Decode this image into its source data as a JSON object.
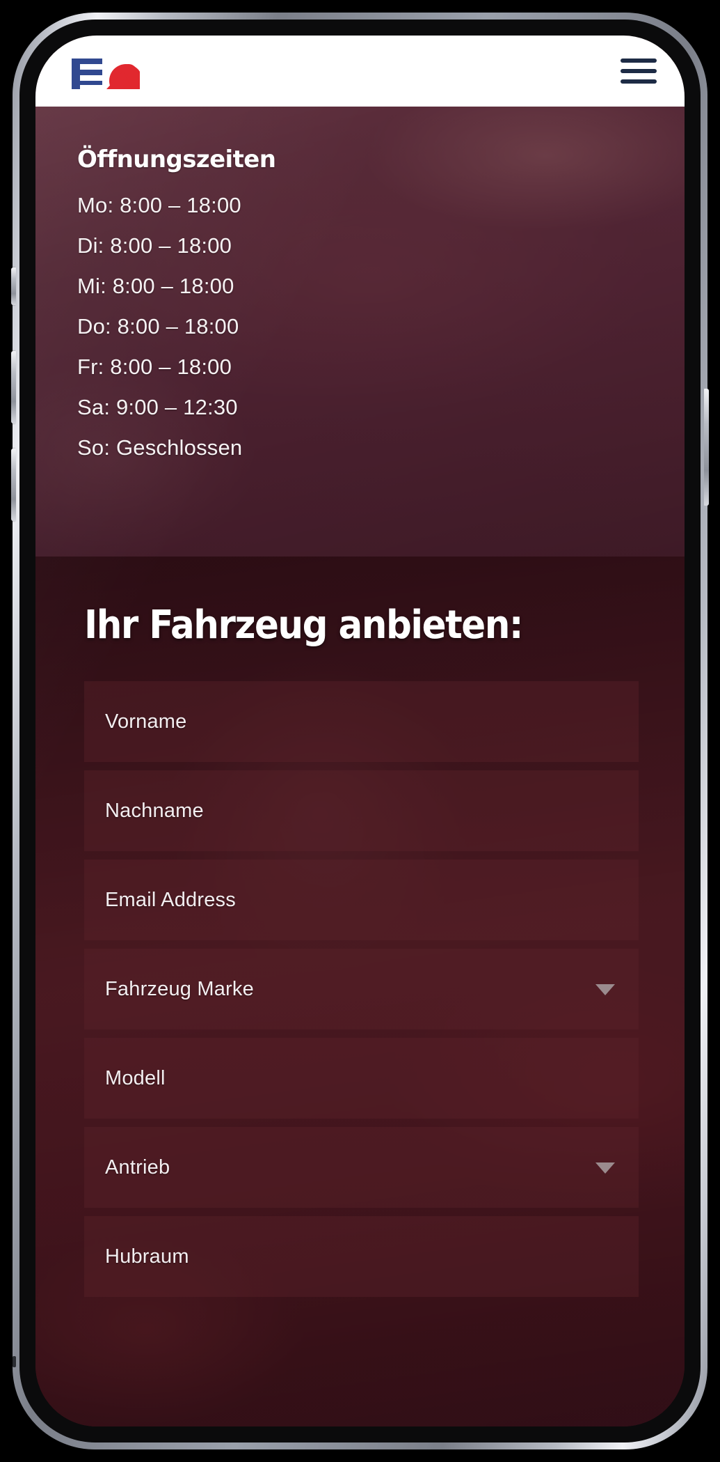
{
  "header": {
    "logo": {
      "icon": "ea-logo-icon",
      "letter_left": "E",
      "letter_right": "A",
      "color_left": "#27408b",
      "color_right": "#e01f26"
    },
    "menu_toggle": {
      "icon": "hamburger-menu-icon",
      "label": "Menü",
      "color": "#1d2b45"
    }
  },
  "opening_hours": {
    "title": "Öffnungszeiten",
    "rows": [
      "Mo: 8:00 – 18:00",
      "Di: 8:00 – 18:00",
      "Mi: 8:00 – 18:00",
      "Do: 8:00 – 18:00",
      "Fr: 8:00 – 18:00",
      "Sa: 9:00 – 12:30",
      "So: Geschlossen"
    ]
  },
  "offer_form": {
    "heading": "Ihr Fahrzeug anbieten:",
    "fields": [
      {
        "name": "vorname",
        "placeholder": "Vorname",
        "value": "",
        "type": "text"
      },
      {
        "name": "nachname",
        "placeholder": "Nachname",
        "value": "",
        "type": "text"
      },
      {
        "name": "email-address",
        "placeholder": "Email Address",
        "value": "",
        "type": "email"
      },
      {
        "name": "fahrzeug-marke",
        "placeholder": "Fahrzeug Marke",
        "value": "",
        "type": "select"
      },
      {
        "name": "modell",
        "placeholder": "Modell",
        "value": "",
        "type": "text"
      },
      {
        "name": "antrieb",
        "placeholder": "Antrieb",
        "value": "",
        "type": "select"
      },
      {
        "name": "hubraum",
        "placeholder": "Hubraum",
        "value": "",
        "type": "text"
      }
    ]
  },
  "device": {
    "buttons": [
      "silence-switch",
      "volume-up-button",
      "volume-down-button",
      "power-button"
    ]
  },
  "colors": {
    "header_background": "#ffffff",
    "hours_section": "#54283a",
    "form_section": "#3a1119",
    "field_fill": "rgba(92,34,42,0.40)",
    "text_on_dark": "#f3eef0",
    "chevron": "#9b8b8e"
  }
}
